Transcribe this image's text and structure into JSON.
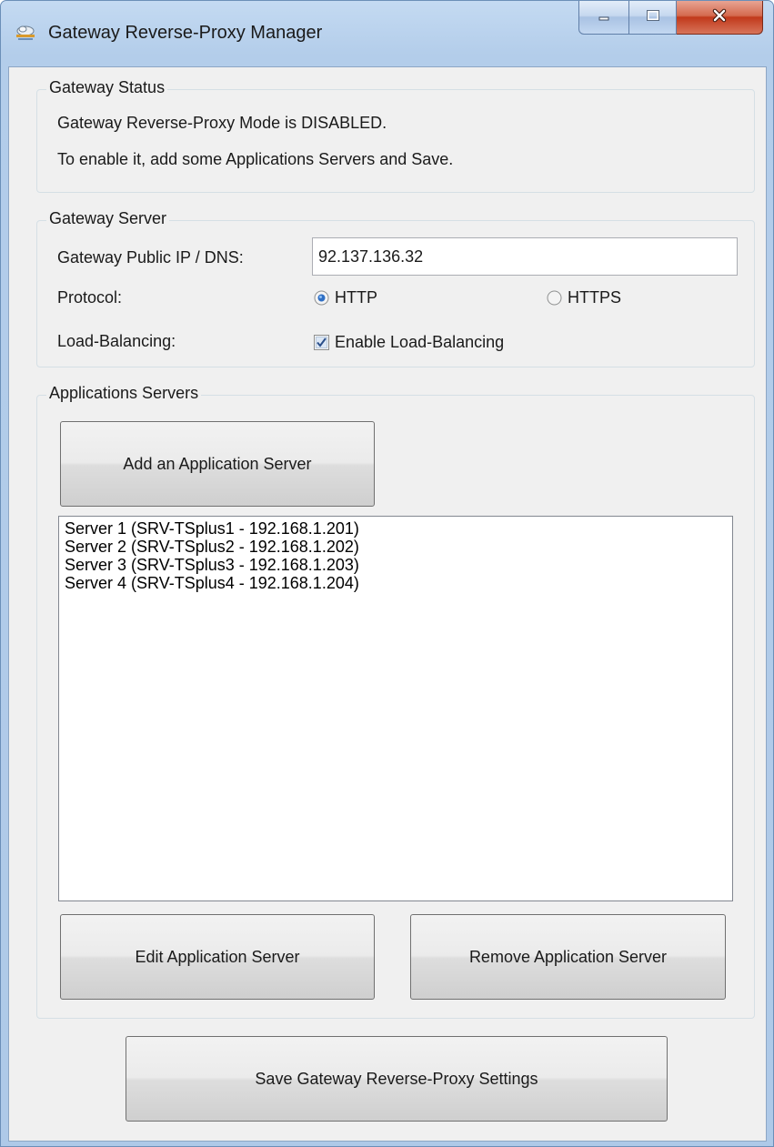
{
  "window": {
    "title": "Gateway Reverse-Proxy Manager"
  },
  "status_group": {
    "title": "Gateway Status",
    "line1": "Gateway Reverse-Proxy Mode is DISABLED.",
    "line2": "To enable it, add some Applications Servers and Save."
  },
  "server_group": {
    "title": "Gateway Server",
    "ip_label": "Gateway Public IP / DNS:",
    "ip_value": "92.137.136.32",
    "protocol_label": "Protocol:",
    "protocol_options": [
      "HTTP",
      "HTTPS"
    ],
    "protocol_selected": "HTTP",
    "lb_label": "Load-Balancing:",
    "lb_checkbox_label": "Enable Load-Balancing",
    "lb_checked": true
  },
  "apps_group": {
    "title": "Applications Servers",
    "add_button": "Add an Application Server",
    "servers": [
      "Server 1 (SRV-TSplus1 - 192.168.1.201)",
      "Server 2 (SRV-TSplus2 - 192.168.1.202)",
      "Server 3 (SRV-TSplus3 - 192.168.1.203)",
      "Server 4 (SRV-TSplus4 - 192.168.1.204)"
    ],
    "edit_button": "Edit Application Server",
    "remove_button": "Remove Application Server"
  },
  "save_button": "Save Gateway Reverse-Proxy Settings",
  "icons": {
    "app": "gateway-cloud-icon",
    "minimize": "minimize-icon",
    "maximize": "maximize-icon",
    "close": "close-icon"
  }
}
